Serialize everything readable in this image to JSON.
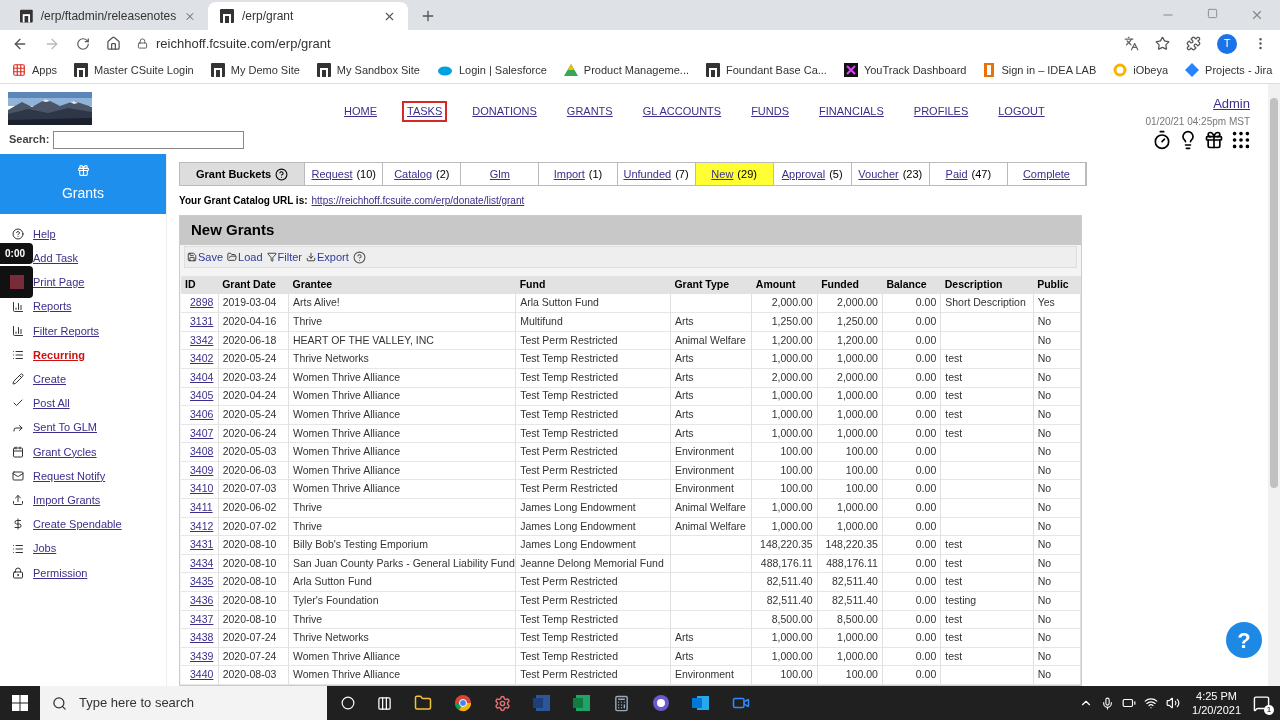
{
  "browser": {
    "tabs": [
      {
        "title": "/erp/ftadmin/releasenotes",
        "selected": false
      },
      {
        "title": "/erp/grant",
        "selected": true
      }
    ],
    "url": "reichhoff.fcsuite.com/erp/grant",
    "avatar": "T",
    "bookmarks": [
      {
        "label": "Apps"
      },
      {
        "label": "Master CSuite Login"
      },
      {
        "label": "My Demo Site"
      },
      {
        "label": "My Sandbox Site"
      },
      {
        "label": "Login | Salesforce"
      },
      {
        "label": "Product Manageme..."
      },
      {
        "label": "Foundant Base Ca..."
      },
      {
        "label": "YouTrack Dashboard"
      },
      {
        "label": "Sign in – IDEA LAB"
      },
      {
        "label": "iObeya"
      },
      {
        "label": "Projects - Jira"
      }
    ]
  },
  "header": {
    "nav": [
      {
        "label": "HOME",
        "selected": false
      },
      {
        "label": "TASKS",
        "selected": true
      },
      {
        "label": "DONATIONS",
        "selected": false
      },
      {
        "label": "GRANTS",
        "selected": false
      },
      {
        "label": "GL ACCOUNTS",
        "selected": false
      },
      {
        "label": "FUNDS",
        "selected": false
      },
      {
        "label": "FINANCIALS",
        "selected": false
      },
      {
        "label": "PROFILES",
        "selected": false
      },
      {
        "label": "LOGOUT",
        "selected": false
      }
    ],
    "user": "Admin",
    "datetime": "01/20/21 04:25pm MST",
    "search_label": "Search:"
  },
  "sidebar": {
    "title": "Grants",
    "items": [
      {
        "label": "Help",
        "selected": false
      },
      {
        "label": "Add Task",
        "selected": false
      },
      {
        "label": "Print Page",
        "selected": false
      },
      {
        "label": "Reports",
        "selected": false
      },
      {
        "label": "Filter Reports",
        "selected": false
      },
      {
        "label": "Recurring",
        "selected": true
      },
      {
        "label": "Create",
        "selected": false
      },
      {
        "label": "Post All",
        "selected": false
      },
      {
        "label": "Sent To GLM",
        "selected": false
      },
      {
        "label": "Grant Cycles",
        "selected": false
      },
      {
        "label": "Request Notify",
        "selected": false
      },
      {
        "label": "Import Grants",
        "selected": false
      },
      {
        "label": "Create Spendable",
        "selected": false
      },
      {
        "label": "Jobs",
        "selected": false
      },
      {
        "label": "Permission",
        "selected": false
      }
    ]
  },
  "buckets": {
    "label": "Grant Buckets",
    "tabs": [
      {
        "label": "Request",
        "count": "(10)",
        "selected": false
      },
      {
        "label": "Catalog",
        "count": "(2)",
        "selected": false
      },
      {
        "label": "Glm",
        "selected": false
      },
      {
        "label": "Import",
        "count": "(1)",
        "selected": false
      },
      {
        "label": "Unfunded",
        "count": "(7)",
        "selected": false
      },
      {
        "label": "New",
        "count": "(29)",
        "selected": true
      },
      {
        "label": "Approval",
        "count": "(5)",
        "selected": false
      },
      {
        "label": "Voucher",
        "count": "(23)",
        "selected": false
      },
      {
        "label": "Paid",
        "count": "(47)",
        "selected": false
      },
      {
        "label": "Complete",
        "selected": false
      }
    ]
  },
  "catalog_url": {
    "label": "Your Grant Catalog URL is:",
    "url": "https://reichhoff.fcsuite.com/erp/donate/list/grant"
  },
  "panel": {
    "title": "New Grants",
    "toolbar": [
      "Save",
      "Load",
      "Filter",
      "Export"
    ],
    "columns": [
      "ID",
      "Grant Date",
      "Grantee",
      "Fund",
      "Grant Type",
      "Amount",
      "Funded",
      "Balance",
      "Description",
      "Public"
    ],
    "rows": [
      {
        "id": "2898",
        "date": "2019-03-04",
        "grantee": "Arts Alive!",
        "fund": "Arla Sutton Fund",
        "amount": "2,000.00",
        "funded": "2,000.00",
        "balance": "0.00",
        "description": "Short Description",
        "public": "Yes"
      },
      {
        "id": "3131",
        "date": "2020-04-16",
        "grantee": "Thrive",
        "fund": "Multifund",
        "type": "Arts",
        "amount": "1,250.00",
        "funded": "1,250.00",
        "balance": "0.00",
        "public": "No"
      },
      {
        "id": "3342",
        "date": "2020-06-18",
        "grantee": "HEART OF THE VALLEY, INC",
        "fund": "Test Perm Restricted",
        "type": "Animal Welfare",
        "amount": "1,200.00",
        "funded": "1,200.00",
        "balance": "0.00",
        "public": "No"
      },
      {
        "id": "3402",
        "date": "2020-05-24",
        "grantee": "Thrive Networks",
        "fund": "Test Temp Restricted",
        "type": "Arts",
        "amount": "1,000.00",
        "funded": "1,000.00",
        "balance": "0.00",
        "description": "test",
        "public": "No"
      },
      {
        "id": "3404",
        "date": "2020-03-24",
        "grantee": "Women Thrive Alliance",
        "fund": "Test Temp Restricted",
        "type": "Arts",
        "amount": "2,000.00",
        "funded": "2,000.00",
        "balance": "0.00",
        "description": "test",
        "public": "No"
      },
      {
        "id": "3405",
        "date": "2020-04-24",
        "grantee": "Women Thrive Alliance",
        "fund": "Test Temp Restricted",
        "type": "Arts",
        "amount": "1,000.00",
        "funded": "1,000.00",
        "balance": "0.00",
        "description": "test",
        "public": "No"
      },
      {
        "id": "3406",
        "date": "2020-05-24",
        "grantee": "Women Thrive Alliance",
        "fund": "Test Temp Restricted",
        "type": "Arts",
        "amount": "1,000.00",
        "funded": "1,000.00",
        "balance": "0.00",
        "description": "test",
        "public": "No"
      },
      {
        "id": "3407",
        "date": "2020-06-24",
        "grantee": "Women Thrive Alliance",
        "fund": "Test Temp Restricted",
        "type": "Arts",
        "amount": "1,000.00",
        "funded": "1,000.00",
        "balance": "0.00",
        "description": "test",
        "public": "No"
      },
      {
        "id": "3408",
        "date": "2020-05-03",
        "grantee": "Women Thrive Alliance",
        "fund": "Test Perm Restricted",
        "type": "Environment",
        "amount": "100.00",
        "funded": "100.00",
        "balance": "0.00",
        "public": "No"
      },
      {
        "id": "3409",
        "date": "2020-06-03",
        "grantee": "Women Thrive Alliance",
        "fund": "Test Perm Restricted",
        "type": "Environment",
        "amount": "100.00",
        "funded": "100.00",
        "balance": "0.00",
        "public": "No"
      },
      {
        "id": "3410",
        "date": "2020-07-03",
        "grantee": "Women Thrive Alliance",
        "fund": "Test Perm Restricted",
        "type": "Environment",
        "amount": "100.00",
        "funded": "100.00",
        "balance": "0.00",
        "public": "No"
      },
      {
        "id": "3411",
        "date": "2020-06-02",
        "grantee": "Thrive",
        "fund": "James Long Endowment",
        "type": "Animal Welfare",
        "amount": "1,000.00",
        "funded": "1,000.00",
        "balance": "0.00",
        "public": "No"
      },
      {
        "id": "3412",
        "date": "2020-07-02",
        "grantee": "Thrive",
        "fund": "James Long Endowment",
        "type": "Animal Welfare",
        "amount": "1,000.00",
        "funded": "1,000.00",
        "balance": "0.00",
        "public": "No"
      },
      {
        "id": "3431",
        "date": "2020-08-10",
        "grantee": "Billy Bob's Testing Emporium",
        "fund": "James Long Endowment",
        "amount": "148,220.35",
        "funded": "148,220.35",
        "balance": "0.00",
        "description": "test",
        "public": "No"
      },
      {
        "id": "3434",
        "date": "2020-08-10",
        "grantee": "San Juan County Parks - General Liability Fund",
        "fund": "Jeanne Delong Memorial Fund",
        "amount": "488,176.11",
        "funded": "488,176.11",
        "balance": "0.00",
        "description": "test",
        "public": "No"
      },
      {
        "id": "3435",
        "date": "2020-08-10",
        "grantee": "Arla Sutton Fund",
        "fund": "Test Perm Restricted",
        "amount": "82,511.40",
        "funded": "82,511.40",
        "balance": "0.00",
        "description": "test",
        "public": "No"
      },
      {
        "id": "3436",
        "date": "2020-08-10",
        "grantee": "Tyler's Foundation",
        "fund": "Test Perm Restricted",
        "amount": "82,511.40",
        "funded": "82,511.40",
        "balance": "0.00",
        "description": "testing",
        "public": "No"
      },
      {
        "id": "3437",
        "date": "2020-08-10",
        "grantee": "Thrive",
        "fund": "Test Temp Restricted",
        "amount": "8,500.00",
        "funded": "8,500.00",
        "balance": "0.00",
        "description": "test",
        "public": "No"
      },
      {
        "id": "3438",
        "date": "2020-07-24",
        "grantee": "Thrive Networks",
        "fund": "Test Temp Restricted",
        "type": "Arts",
        "amount": "1,000.00",
        "funded": "1,000.00",
        "balance": "0.00",
        "description": "test",
        "public": "No"
      },
      {
        "id": "3439",
        "date": "2020-07-24",
        "grantee": "Women Thrive Alliance",
        "fund": "Test Temp Restricted",
        "type": "Arts",
        "amount": "1,000.00",
        "funded": "1,000.00",
        "balance": "0.00",
        "description": "test",
        "public": "No"
      },
      {
        "id": "3440",
        "date": "2020-08-03",
        "grantee": "Women Thrive Alliance",
        "fund": "Test Perm Restricted",
        "type": "Environment",
        "amount": "100.00",
        "funded": "100.00",
        "balance": "0.00",
        "public": "No"
      }
    ]
  },
  "recorder": {
    "time": "0:00"
  },
  "help_button": "?",
  "taskbar": {
    "search_placeholder": "Type here to search",
    "time": "4:25 PM",
    "date": "1/20/2021",
    "notifications": "1"
  }
}
